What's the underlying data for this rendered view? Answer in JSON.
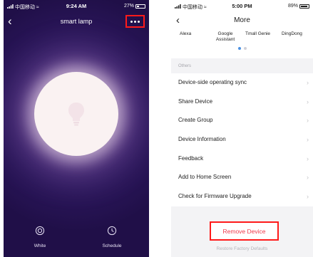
{
  "left_screen": {
    "status_bar": {
      "carrier": "中国移动",
      "time": "9:24 AM",
      "battery": "27%",
      "battery_level": 0.27
    },
    "title": "smart lamp",
    "bottom_tabs": [
      {
        "label": "White",
        "icon": "power-icon"
      },
      {
        "label": "Schedule",
        "icon": "clock-icon"
      }
    ],
    "icons": {
      "back": "back-chevron-icon",
      "more": "more-dots-icon",
      "lamp": "lightbulb-icon"
    }
  },
  "right_screen": {
    "status_bar": {
      "carrier": "中国移动",
      "time": "5:00 PM",
      "battery": "89%",
      "battery_level": 0.89
    },
    "title": "More",
    "assistants": [
      "Alexa",
      "Google Assistant",
      "Tmall Genie",
      "DingDong"
    ],
    "section_label": "Others",
    "menu_items": [
      "Device-side operating sync",
      "Share Device",
      "Create Group",
      "Device Information",
      "Feedback",
      "Add to Home Screen",
      "Check for Firmware Upgrade"
    ],
    "remove_label": "Remove Device",
    "restore_label": "Restore Factory Defaults"
  },
  "colors": {
    "highlight": "#ff1a1a",
    "remove_text": "#f0394b",
    "page_dot_active": "#4a90e2",
    "page_dot_inactive": "#d0d0d8"
  }
}
